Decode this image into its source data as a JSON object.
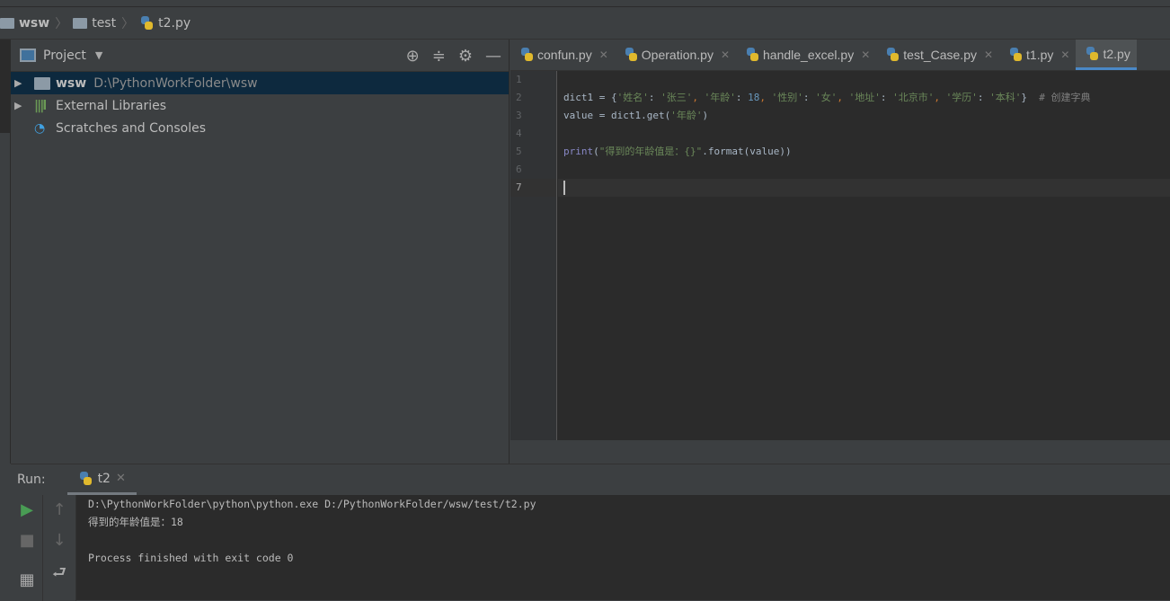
{
  "breadcrumb": [
    "wsw",
    "test",
    "t2.py"
  ],
  "project": {
    "title": "Project",
    "tree": [
      {
        "name": "wsw",
        "path": "D:\\PythonWorkFolder\\wsw",
        "selected": true
      },
      {
        "name": "External Libraries"
      },
      {
        "name": "Scratches and Consoles"
      }
    ]
  },
  "editor": {
    "tabs": [
      "confun.py",
      "Operation.py",
      "handle_excel.py",
      "test_Case.py",
      "t1.py",
      "t2.py"
    ],
    "active_tab": "t2.py",
    "line_numbers": [
      "1",
      "2",
      "3",
      "4",
      "5",
      "6",
      "7"
    ],
    "code": {
      "l2": {
        "a": "dict1 = {",
        "s1": "'姓名'",
        "c1": ": ",
        "s2": "'张三'",
        "k1": ", ",
        "s3": "'年龄'",
        "c2": ": ",
        "n1": "18",
        "k2": ", ",
        "s4": "'性别'",
        "c3": ": ",
        "s5": "'女'",
        "k3": ", ",
        "s6": "'地址'",
        "c4": ": ",
        "s7": "'北京市'",
        "k4": ", ",
        "s8": "'学历'",
        "c5": ": ",
        "s9": "'本科'",
        "e": "}",
        "cm": "  # 创建字典"
      },
      "l3": {
        "a": "value = dict1.get(",
        "s": "'年龄'",
        "e": ")"
      },
      "l5": {
        "p": "print",
        "a": "(",
        "s": "\"得到的年龄值是：{}\"",
        "e": ".format(value))"
      }
    }
  },
  "run": {
    "label": "Run:",
    "tab": "t2",
    "output": [
      "D:\\PythonWorkFolder\\python\\python.exe D:/PythonWorkFolder/wsw/test/t2.py",
      "得到的年龄值是：18",
      "",
      "Process finished with exit code 0"
    ]
  },
  "colors": {
    "accent": "#4a88c7",
    "selection": "#0d293e",
    "string": "#6a8759",
    "number": "#6897bb",
    "run_green": "#499c54"
  }
}
